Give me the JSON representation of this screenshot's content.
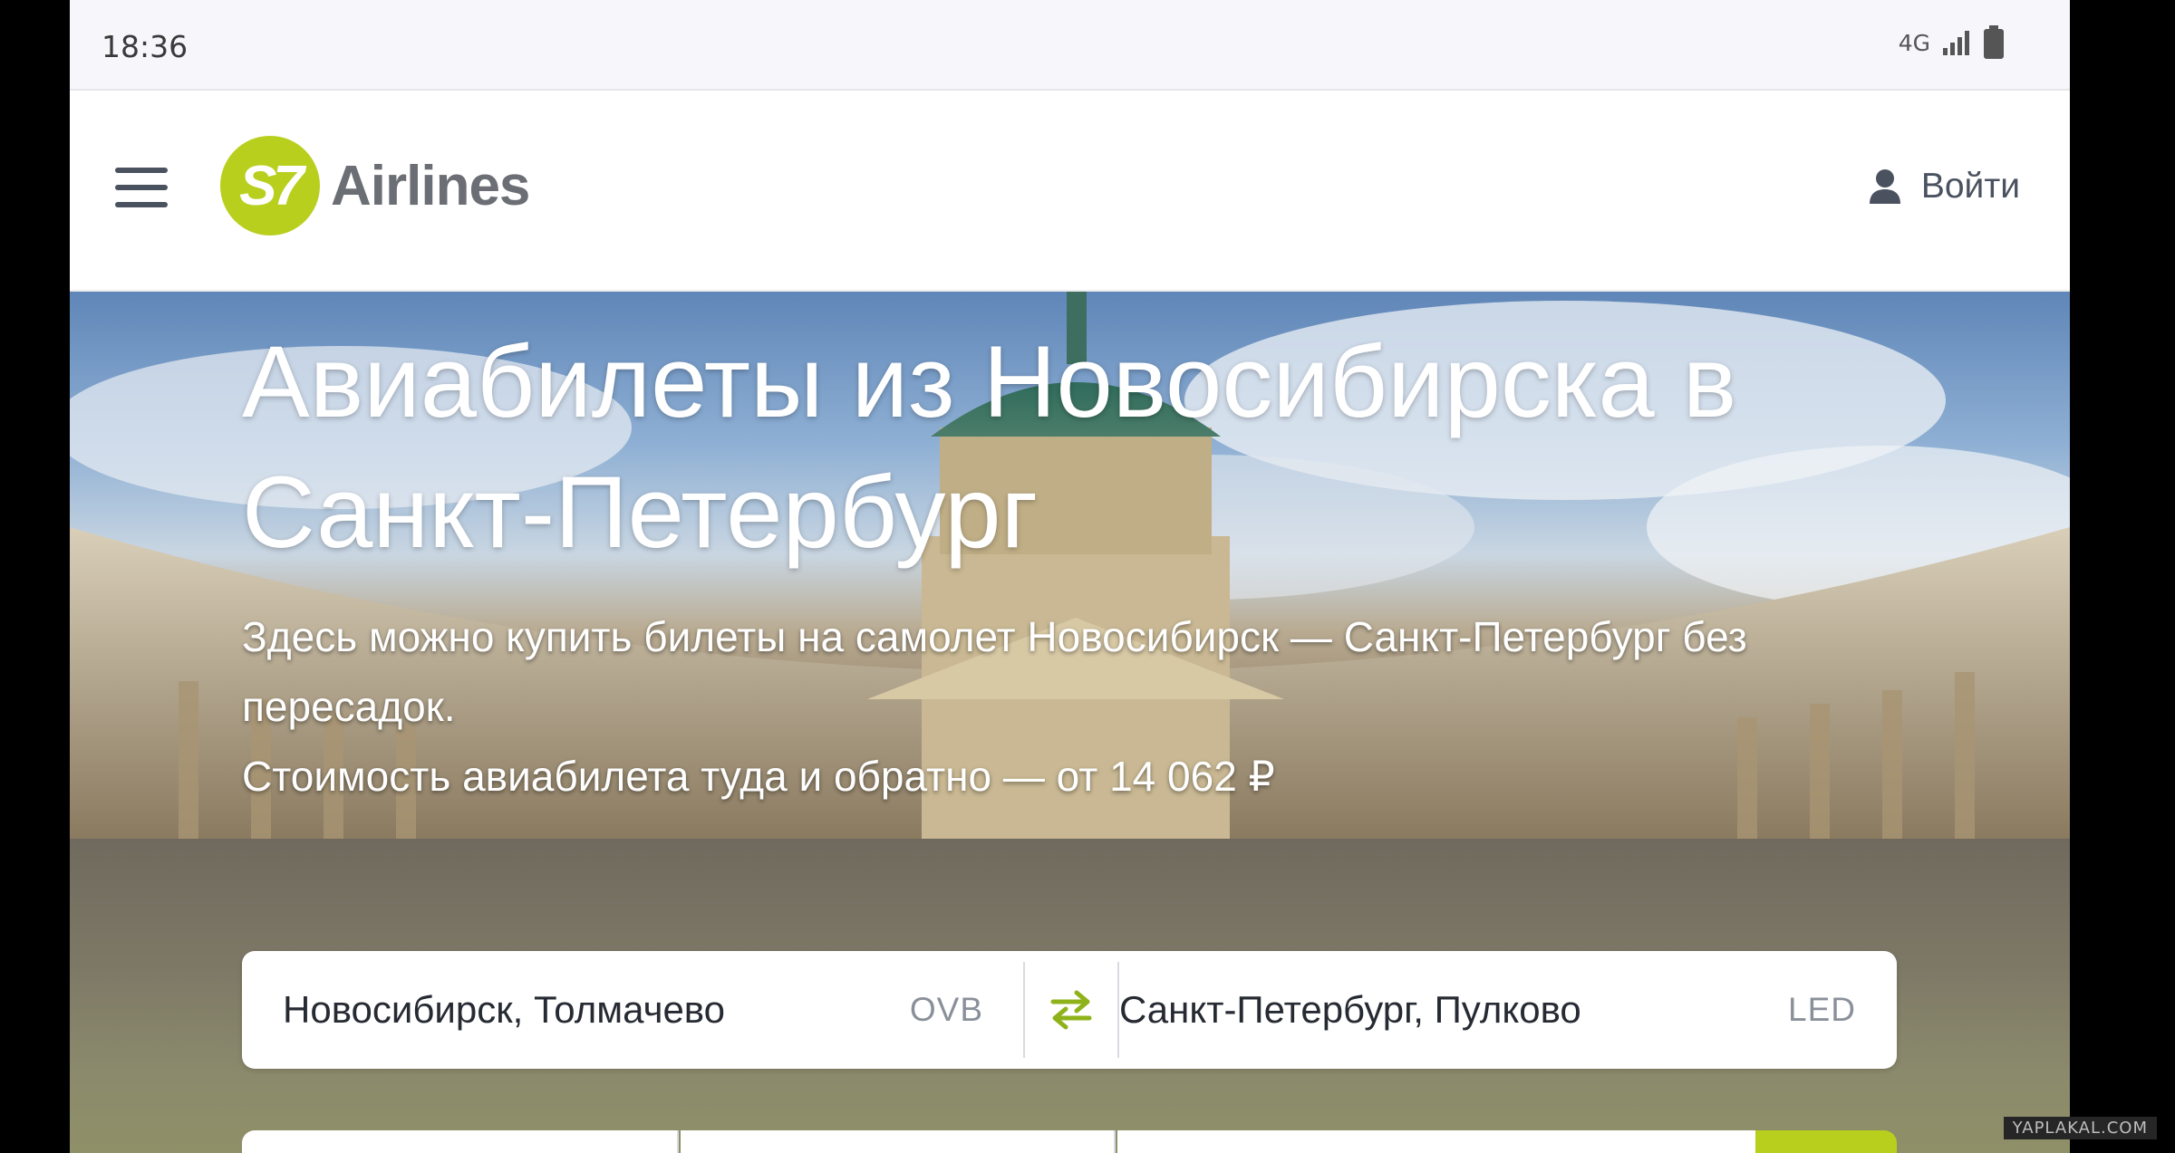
{
  "status_bar": {
    "time": "18:36",
    "network": "4G",
    "icons": [
      "signal-icon",
      "battery-icon"
    ]
  },
  "header": {
    "logo_mark": "S7",
    "logo_text": "Airlines",
    "login_label": "Войти",
    "icons": [
      "menu-icon",
      "user-icon"
    ]
  },
  "hero": {
    "title": "Авиабилеты из Новосибирска в Санкт-Петербург",
    "subtitle_line1": "Здесь можно купить билеты на самолет Новосибирск — Санкт-Петербург без пересадок.",
    "subtitle_line2": "Стоимость авиабилета туда и обратно — от 14 062 ₽"
  },
  "search": {
    "from_city": "Новосибирск, Толмачево",
    "from_code": "OVB",
    "to_city": "Санкт-Петербург, Пулково",
    "to_code": "LED",
    "swap_icon": "swap-arrows-icon"
  },
  "colors": {
    "brand": "#b9cf1e",
    "text_dark": "#262a32",
    "text_muted": "#8a909a"
  },
  "watermark": "YAPLAKAL.COM"
}
